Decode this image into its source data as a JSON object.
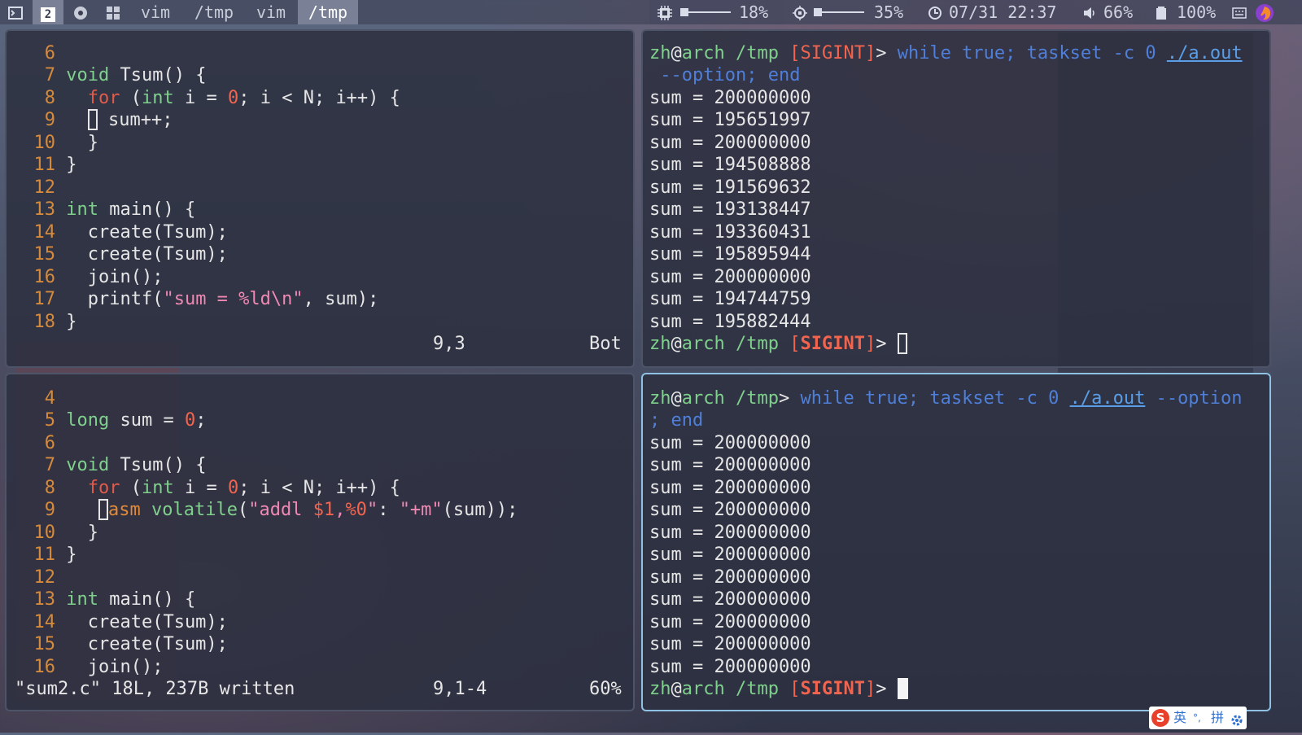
{
  "topbar": {
    "workspaces": [
      {
        "label": "2",
        "active": true
      },
      {
        "label": "vim",
        "active": false
      },
      {
        "label": "/tmp",
        "active": false
      },
      {
        "label": "vim",
        "active": false
      },
      {
        "label": "/tmp",
        "active": true
      }
    ],
    "cpu_label": "18%",
    "mem_label": "35%",
    "datetime": "07/31 22:37",
    "volume_label": "66%",
    "battery_label": "100%"
  },
  "pane_top_left": {
    "lines": [
      {
        "n": "6",
        "code": ""
      },
      {
        "n": "7",
        "code": "void Tsum() {"
      },
      {
        "n": "8",
        "code": "  for (int i = 0; i < N; i++) {"
      },
      {
        "n": "9",
        "code": "    sum++;"
      },
      {
        "n": "10",
        "code": "  }"
      },
      {
        "n": "11",
        "code": "}"
      },
      {
        "n": "12",
        "code": ""
      },
      {
        "n": "13",
        "code": "int main() {"
      },
      {
        "n": "14",
        "code": "  create(Tsum);"
      },
      {
        "n": "15",
        "code": "  create(Tsum);"
      },
      {
        "n": "16",
        "code": "  join();"
      },
      {
        "n": "17",
        "code": "  printf(\"sum = %ld\\n\", sum);"
      },
      {
        "n": "18",
        "code": "}"
      }
    ],
    "position": "9,3",
    "scroll": "Bot"
  },
  "pane_bottom_left": {
    "lines": [
      {
        "n": "4",
        "code": ""
      },
      {
        "n": "5",
        "code": "long sum = 0;"
      },
      {
        "n": "6",
        "code": ""
      },
      {
        "n": "7",
        "code": "void Tsum() {"
      },
      {
        "n": "8",
        "code": "  for (int i = 0; i < N; i++) {"
      },
      {
        "n": "9",
        "code": "    asm volatile(\"addl $1,%0\": \"+m\"(sum));"
      },
      {
        "n": "10",
        "code": "  }"
      },
      {
        "n": "11",
        "code": "}"
      },
      {
        "n": "12",
        "code": ""
      },
      {
        "n": "13",
        "code": "int main() {"
      },
      {
        "n": "14",
        "code": "  create(Tsum);"
      },
      {
        "n": "15",
        "code": "  create(Tsum);"
      },
      {
        "n": "16",
        "code": "  join();"
      }
    ],
    "message": "\"sum2.c\" 18L, 237B written",
    "position": "9,1-4",
    "scroll": "60%"
  },
  "pane_top_right": {
    "prompt_user": "zh",
    "prompt_host": "arch",
    "prompt_path": "/tmp",
    "prompt_status": "SIGINT",
    "command_part1": "while true; taskset -c 0 ",
    "command_link": "./a.out",
    "command_part2": "--option; end",
    "outputs": [
      "sum = 200000000",
      "sum = 195651997",
      "sum = 200000000",
      "sum = 194508888",
      "sum = 191569632",
      "sum = 193138447",
      "sum = 193360431",
      "sum = 195895944",
      "sum = 200000000",
      "sum = 194744759",
      "sum = 195882444"
    ]
  },
  "pane_bottom_right": {
    "command_part1": "while true; taskset -c 0 ",
    "command_link": "./a.out",
    "command_part2": " --option",
    "command_part3": "; end",
    "outputs": [
      "sum = 200000000",
      "sum = 200000000",
      "sum = 200000000",
      "sum = 200000000",
      "sum = 200000000",
      "sum = 200000000",
      "sum = 200000000",
      "sum = 200000000",
      "sum = 200000000",
      "sum = 200000000",
      "sum = 200000000"
    ]
  },
  "ime": {
    "mode": "英",
    "punct": "°,",
    "method": "拼"
  },
  "colors": {
    "focused_border": "#8fc1e3",
    "keyword": "#e05b4a",
    "type": "#7fd08c",
    "string": "#f088b4",
    "line_number": "#d58a3c",
    "command": "#4f7fd8"
  }
}
